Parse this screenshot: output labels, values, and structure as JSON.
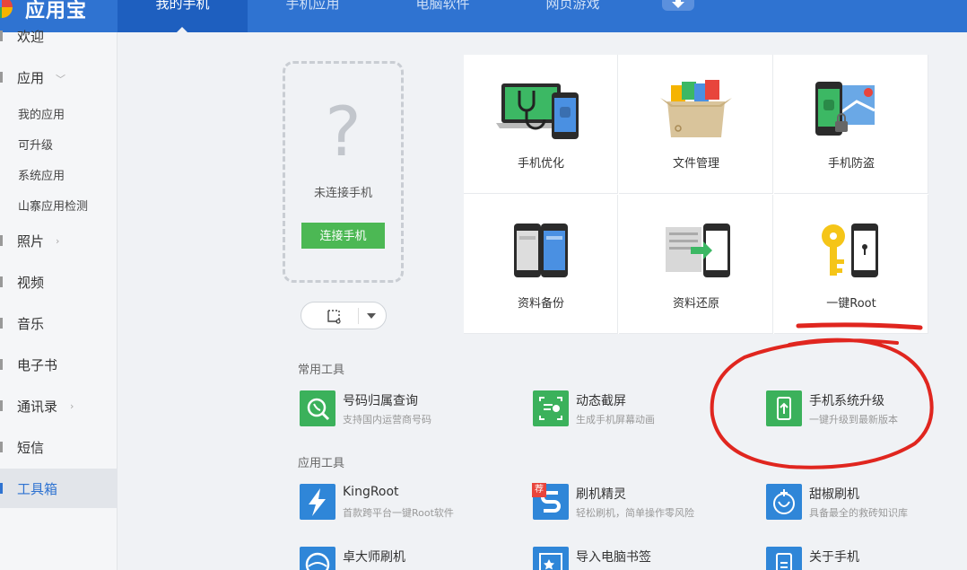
{
  "app": {
    "logo_text": "应用宝"
  },
  "nav": {
    "tabs": [
      {
        "label": "我的手机"
      },
      {
        "label": "手机应用"
      },
      {
        "label": "电脑软件"
      },
      {
        "label": "网页游戏"
      }
    ]
  },
  "sidebar": {
    "items": [
      {
        "label": "欢迎"
      },
      {
        "label": "应用"
      },
      {
        "label": "照片"
      },
      {
        "label": "视频"
      },
      {
        "label": "音乐"
      },
      {
        "label": "电子书"
      },
      {
        "label": "通讯录"
      },
      {
        "label": "短信"
      },
      {
        "label": "工具箱"
      }
    ],
    "apps_sub": [
      {
        "label": "我的应用"
      },
      {
        "label": "可升级"
      },
      {
        "label": "系统应用"
      },
      {
        "label": "山寨应用检测"
      }
    ]
  },
  "phone": {
    "placeholder": "?",
    "status": "未连接手机",
    "connect_label": "连接手机"
  },
  "features": [
    {
      "label": "手机优化"
    },
    {
      "label": "文件管理"
    },
    {
      "label": "手机防盗"
    },
    {
      "label": "资料备份"
    },
    {
      "label": "资料还原"
    },
    {
      "label": "一键Root"
    }
  ],
  "common_tools": {
    "title": "常用工具",
    "items": [
      {
        "name": "号码归属查询",
        "desc": "支持国内运营商号码"
      },
      {
        "name": "动态截屏",
        "desc": "生成手机屏幕动画"
      },
      {
        "name": "手机系统升级",
        "desc": "一键升级到最新版本"
      }
    ]
  },
  "app_tools": {
    "title": "应用工具",
    "items": [
      {
        "name": "KingRoot",
        "desc": "首款跨平台一键Root软件"
      },
      {
        "name": "刷机精灵",
        "desc": "轻松刷机，简单操作零风险",
        "badge": "荐"
      },
      {
        "name": "甜椒刷机",
        "desc": "具备最全的救砖知识库"
      },
      {
        "name": "卓大师刷机",
        "desc": ""
      },
      {
        "name": "导入电脑书签",
        "desc": ""
      },
      {
        "name": "关于手机",
        "desc": ""
      }
    ]
  },
  "colors": {
    "accent": "#2f73d1",
    "green": "#4cb854",
    "annotation": "#e0261f"
  }
}
